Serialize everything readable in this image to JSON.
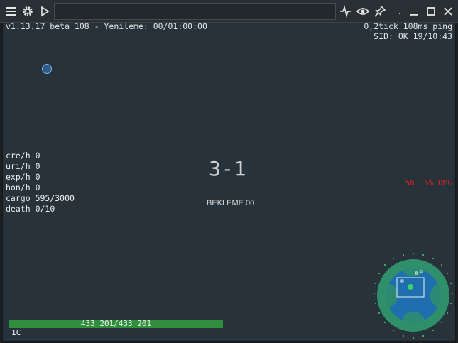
{
  "window": {
    "icons": [
      "menu-icon",
      "gear-icon",
      "play-icon",
      "activity-icon",
      "eye-icon",
      "pin-icon",
      "minimize-icon",
      "maximize-icon",
      "close-icon"
    ],
    "dot_label": ".",
    "address_value": ""
  },
  "hud": {
    "version_line": "v1.13.17 beta 108 - Yenileme: 00/01:00:00",
    "ping_line": "0,2tick 108ms ping",
    "sid_line": "SID: OK 19/10:43"
  },
  "stats": [
    {
      "label": "cre/h",
      "value": "0"
    },
    {
      "label": "uri/h",
      "value": "0"
    },
    {
      "label": "exp/h",
      "value": "0"
    },
    {
      "label": "hon/h",
      "value": "0"
    },
    {
      "label": "cargo",
      "value": "595/3000"
    },
    {
      "label": "death",
      "value": "0/10"
    }
  ],
  "center": {
    "wave": "3-1",
    "waiting": "BEKLEME 00"
  },
  "damage": {
    "text": "5h  5% DMG",
    "color": "#e02020"
  },
  "hp": {
    "text": "433 201/433 201",
    "fraction": 1.0,
    "color": "#2f8f3c"
  },
  "ammo": "1C",
  "colors": {
    "background": "#27323a",
    "titlebar": "#2a2f33",
    "minimap_land": "#2f8f6a",
    "minimap_water": "#1f6fae"
  }
}
